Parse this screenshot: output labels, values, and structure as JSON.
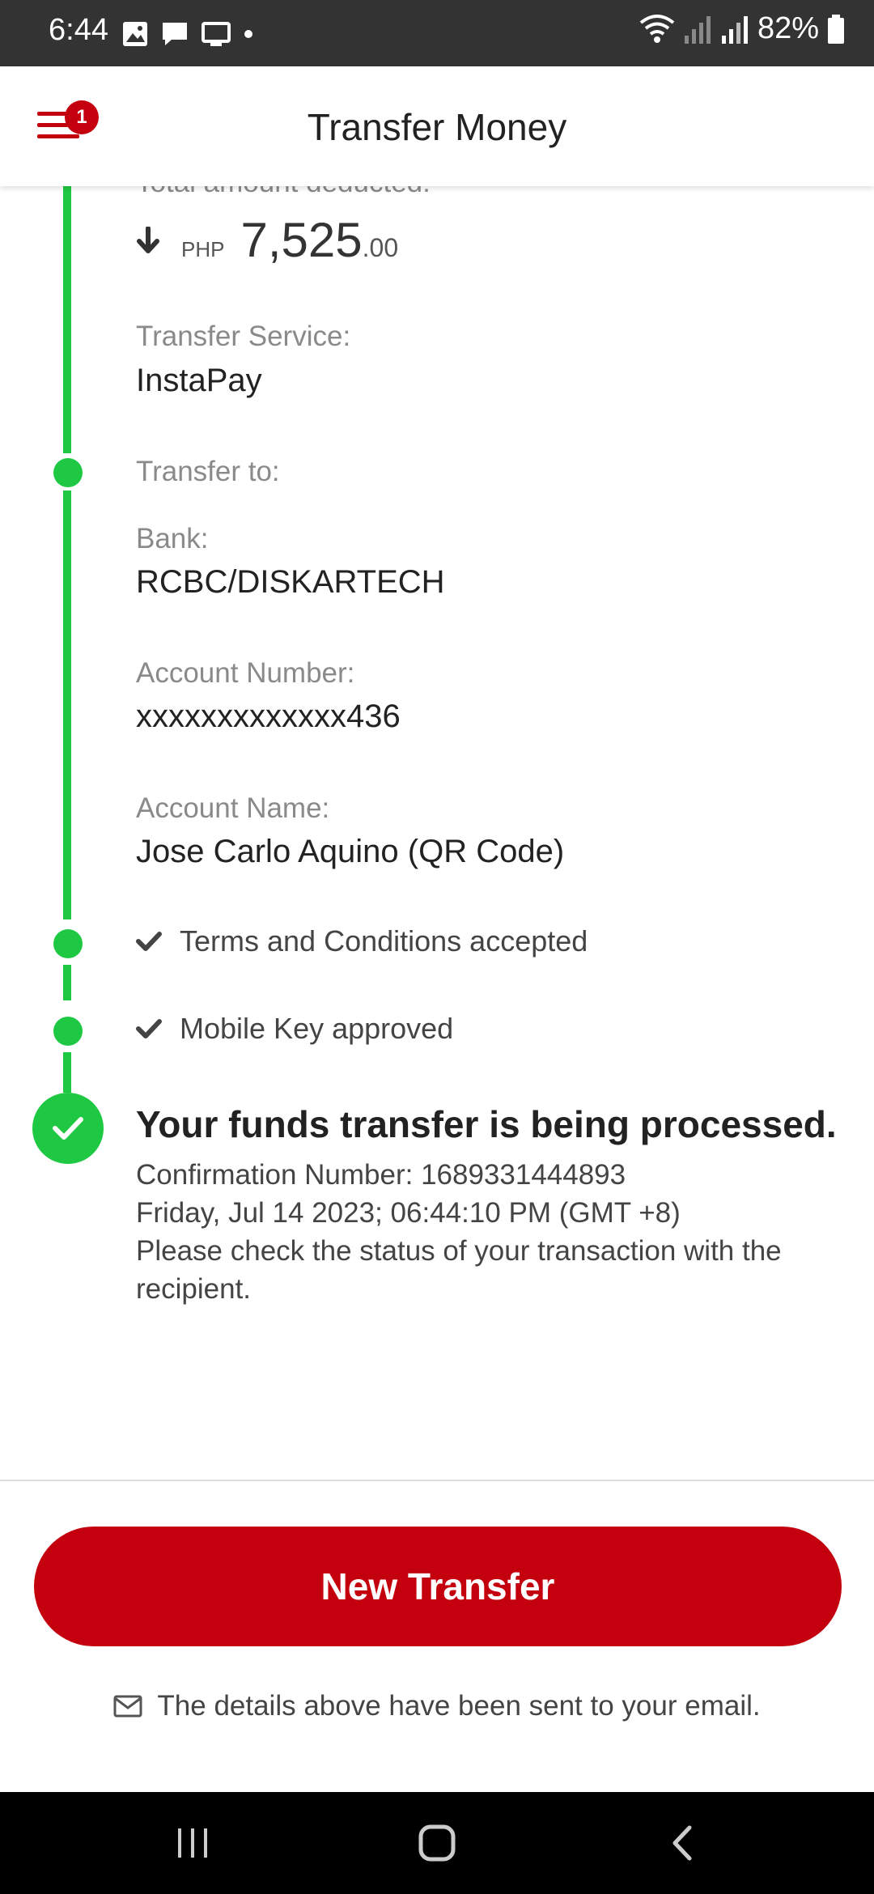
{
  "status_bar": {
    "time": "6:44",
    "battery": "82%"
  },
  "header": {
    "title": "Transfer Money",
    "notification_count": "1"
  },
  "details": {
    "amount_label": "Total amount deducted:",
    "currency": "PHP",
    "amount_whole": "7,525",
    "amount_cents": ".00",
    "service_label": "Transfer Service:",
    "service_value": "InstaPay",
    "transfer_to_label": "Transfer to:",
    "bank_label": "Bank:",
    "bank_value": "RCBC/DISKARTECH",
    "account_number_label": "Account Number:",
    "account_number_value": "xxxxxxxxxxxxx436",
    "account_name_label": "Account Name:",
    "account_name_value": "Jose Carlo Aquino (QR Code)"
  },
  "checks": {
    "terms": "Terms and Conditions accepted",
    "mobile_key": "Mobile Key approved"
  },
  "success": {
    "title": "Your funds transfer is being processed.",
    "confirmation": "Confirmation Number: 1689331444893",
    "datetime": "Friday, Jul 14 2023; 06:44:10 PM (GMT +8)",
    "note": "Please check the status of your transaction with the recipient."
  },
  "actions": {
    "new_transfer": "New Transfer",
    "email_note": "The details above have been sent to your email."
  },
  "colors": {
    "brand_red": "#c4000e",
    "timeline_green": "#1ec842",
    "status_bar": "#333333"
  },
  "icons": {
    "status_left": [
      "image-icon",
      "message-icon",
      "cast-icon",
      "dot-icon"
    ],
    "status_right": [
      "wifi-icon",
      "signal-icon",
      "signal-icon",
      "battery-icon"
    ],
    "nav": [
      "recent-apps-icon",
      "home-icon",
      "back-icon"
    ]
  }
}
